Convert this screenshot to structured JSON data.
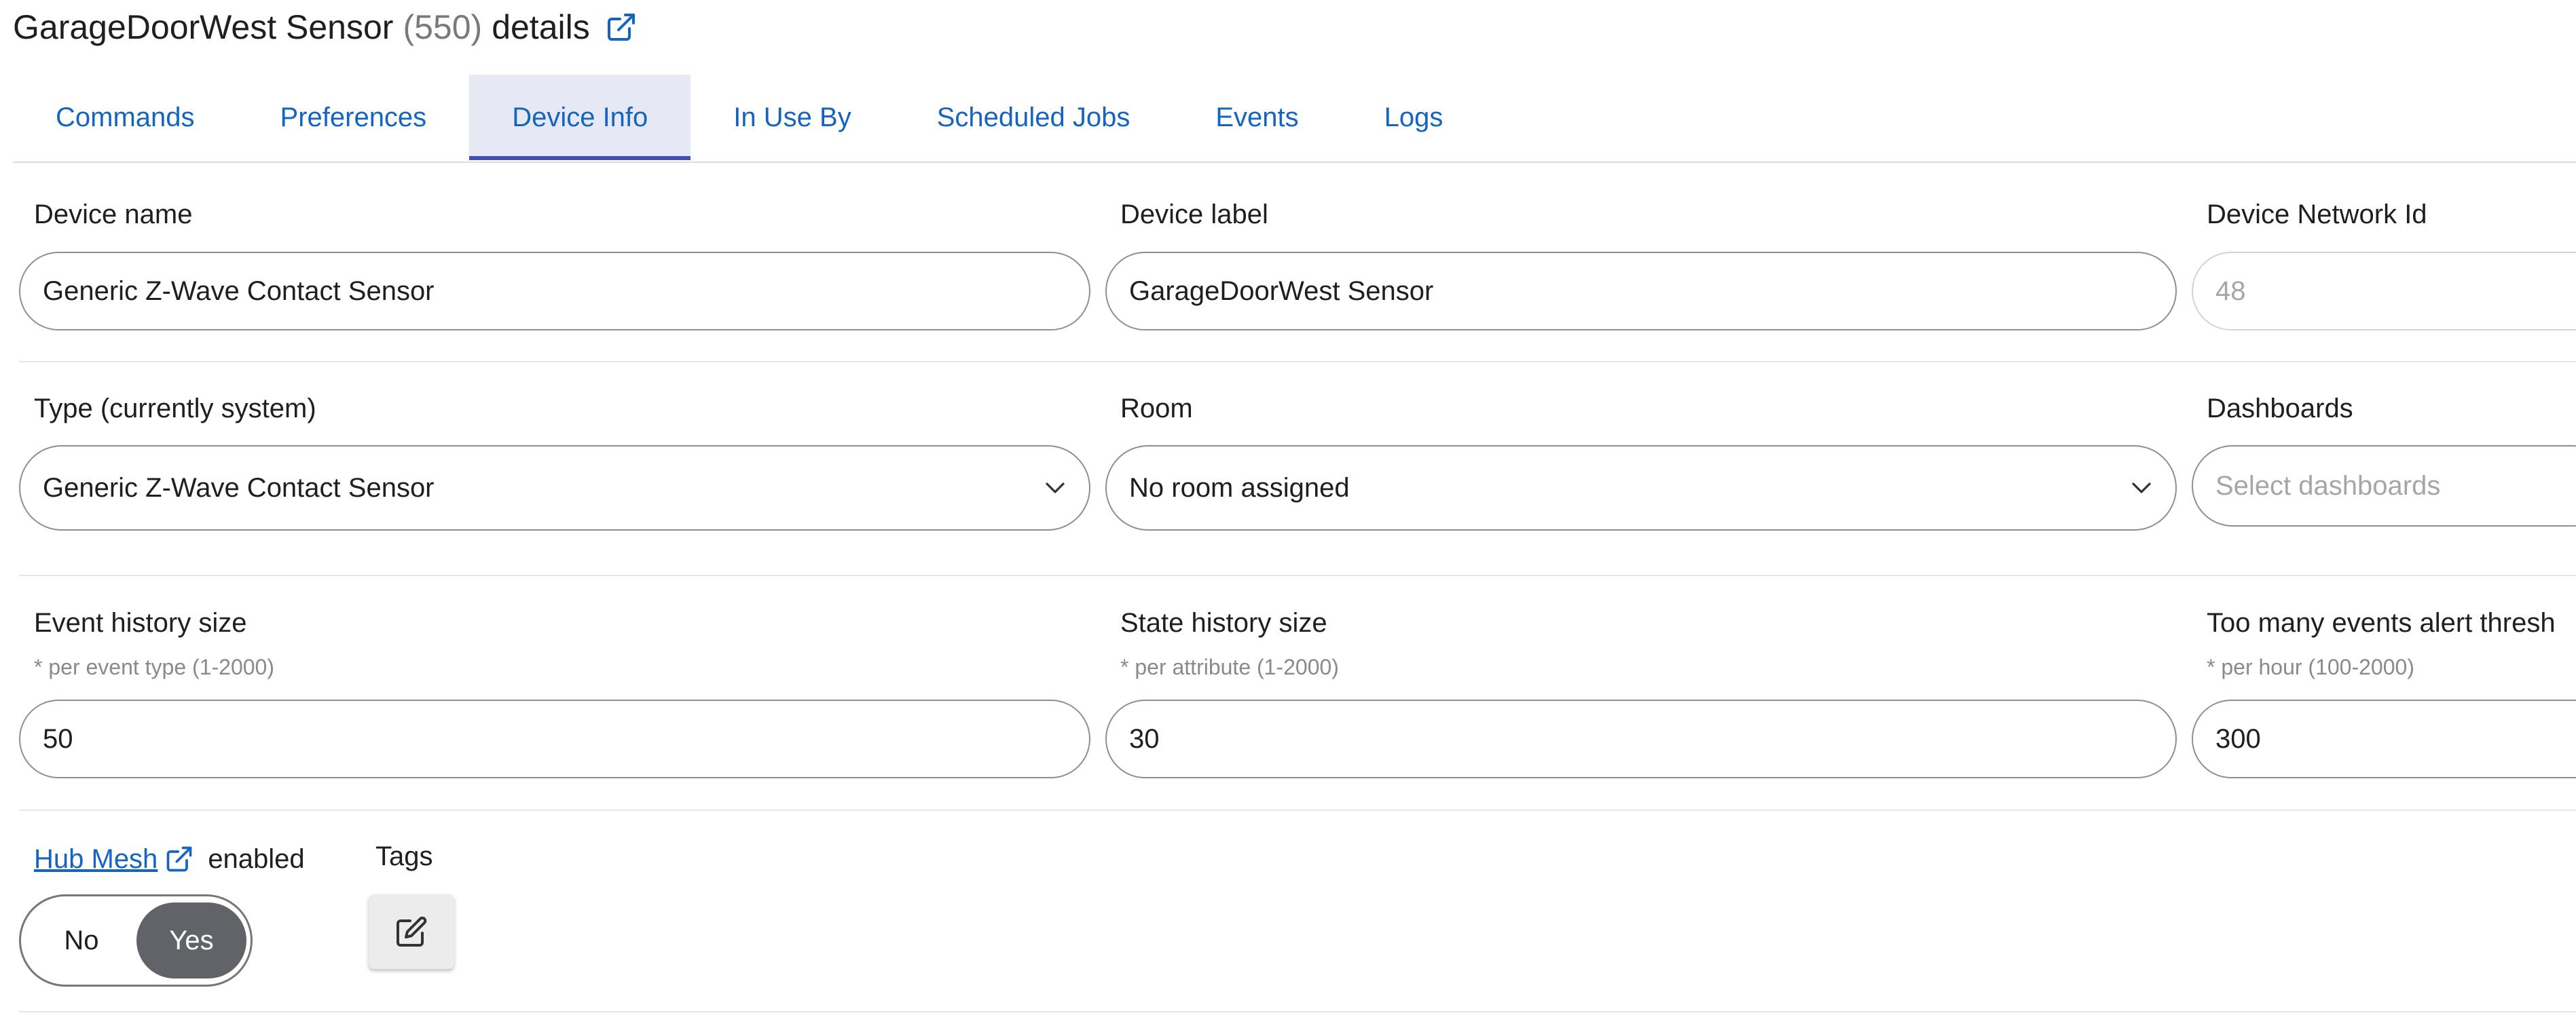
{
  "header": {
    "device": "GarageDoorWest Sensor",
    "count": "(550)",
    "suffix": "details"
  },
  "tabs": [
    {
      "label": "Commands",
      "active": false
    },
    {
      "label": "Preferences",
      "active": false
    },
    {
      "label": "Device Info",
      "active": true
    },
    {
      "label": "In Use By",
      "active": false
    },
    {
      "label": "Scheduled Jobs",
      "active": false
    },
    {
      "label": "Events",
      "active": false
    },
    {
      "label": "Logs",
      "active": false
    }
  ],
  "fields": {
    "device_name": {
      "label": "Device name",
      "value": "Generic Z-Wave Contact Sensor"
    },
    "device_label": {
      "label": "Device label",
      "value": "GarageDoorWest Sensor"
    },
    "network_id": {
      "label": "Device Network Id",
      "value": "48"
    },
    "type": {
      "label": "Type (currently system)",
      "value": "Generic Z-Wave Contact Sensor"
    },
    "room": {
      "label": "Room",
      "value": "No room assigned"
    },
    "dashboards": {
      "label": "Dashboards",
      "placeholder": "Select dashboards"
    },
    "event_history": {
      "label": "Event history size",
      "hint": "* per event type (1-2000)",
      "value": "50"
    },
    "state_history": {
      "label": "State history size",
      "hint": "* per attribute (1-2000)",
      "value": "30"
    },
    "alert_threshold": {
      "label": "Too many events alert thresh",
      "hint": "* per hour (100-2000)",
      "value": "300"
    }
  },
  "hub_mesh": {
    "link_label": "Hub Mesh",
    "suffix": "enabled",
    "options": [
      "No",
      "Yes"
    ],
    "selected": "Yes"
  },
  "tags": {
    "label": "Tags"
  },
  "colors": {
    "link": "#1565c0",
    "tab_active_bg": "#e6e9f5",
    "tab_indicator": "#3f51b5",
    "toggle_on": "#616368"
  }
}
